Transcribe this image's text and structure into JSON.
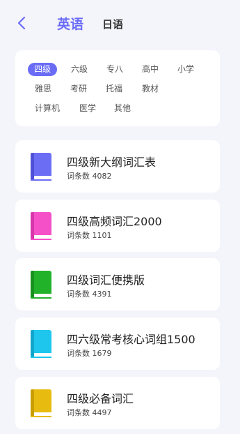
{
  "header": {
    "back_icon": "chevron-left-icon",
    "tabs": [
      "英语",
      "日语"
    ]
  },
  "categories": {
    "row1": [
      "四级",
      "六级",
      "专八",
      "高中",
      "小学"
    ],
    "row2": [
      "雅思",
      "考研",
      "托福",
      "教材"
    ],
    "row3": [
      "计算机",
      "医学",
      "其他"
    ],
    "selected": "四级"
  },
  "books": [
    {
      "title": "四级新大纲词汇表",
      "count": "词条数 4082",
      "color": "#6b6ef5",
      "icon": "book-icon"
    },
    {
      "title": "四级高频词汇2000",
      "count": "词条数 1101",
      "color": "#f550c8",
      "icon": "book-icon"
    },
    {
      "title": "四级词汇便携版",
      "count": "词条数 4391",
      "color": "#21b22a",
      "icon": "book-icon"
    },
    {
      "title": "四六级常考核心词组1500",
      "count": "词条数 1679",
      "color": "#1ec6ee",
      "icon": "book-icon"
    },
    {
      "title": "四级必备词汇",
      "count": "词条数 4497",
      "color": "#e8bb10",
      "icon": "book-icon"
    }
  ],
  "theme": {
    "accent": "#6a6cf6",
    "background": "#f4f4fb"
  }
}
